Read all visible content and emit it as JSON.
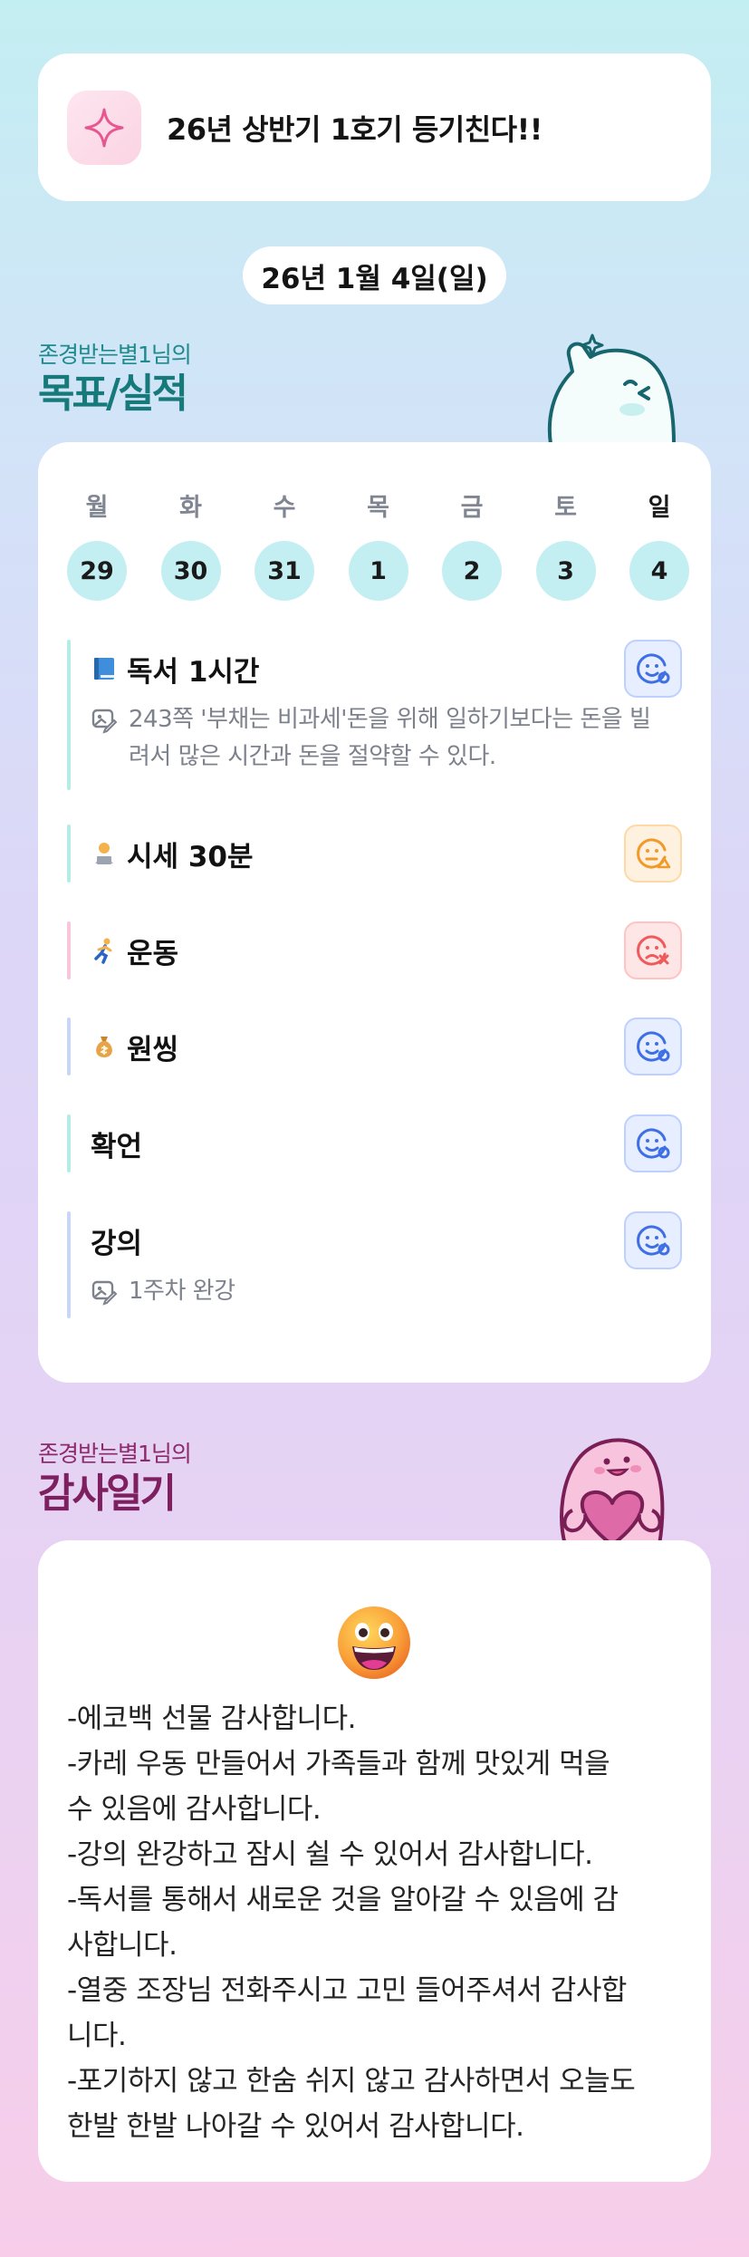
{
  "banner": {
    "text": "26년 상반기 1호기 등기친다!!",
    "icon": "sparkle-icon"
  },
  "date": "26년 1월 4일(일)",
  "goals_section": {
    "subtitle": "존경받는별1님의",
    "title": "목표/실적"
  },
  "week": [
    {
      "day": "월",
      "num": "29",
      "today": false
    },
    {
      "day": "화",
      "num": "30",
      "today": false
    },
    {
      "day": "수",
      "num": "31",
      "today": false
    },
    {
      "day": "목",
      "num": "1",
      "today": false
    },
    {
      "day": "금",
      "num": "2",
      "today": false
    },
    {
      "day": "토",
      "num": "3",
      "today": false
    },
    {
      "day": "일",
      "num": "4",
      "today": true
    }
  ],
  "tasks": [
    {
      "title": "독서 1시간",
      "emoji": "blue-book-icon",
      "note": "243쪽 '부채는 비과세'돈을 위해 일하기보다는 돈을 빌려서 많은 시간과 돈을 절약할 수 있다.",
      "mood": "good",
      "bar_color": "#b4ece7"
    },
    {
      "title": "시세 30분",
      "emoji": "laptop-person-icon",
      "note": "",
      "mood": "meh",
      "bar_color": "#b4ece7"
    },
    {
      "title": "운동",
      "emoji": "runner-icon",
      "note": "",
      "mood": "bad",
      "bar_color": "#f7c6dc"
    },
    {
      "title": "원씽",
      "emoji": "money-bag-icon",
      "note": "",
      "mood": "good",
      "bar_color": "#c9d6f5"
    },
    {
      "title": "확언",
      "emoji": "",
      "note": "",
      "mood": "good",
      "bar_color": "#b4ece7"
    },
    {
      "title": "강의",
      "emoji": "",
      "note": "1주차 완강",
      "mood": "good",
      "bar_color": "#c9d6f5"
    }
  ],
  "thanks_section": {
    "subtitle": "존경받는별1님의",
    "title": "감사일기"
  },
  "thanks": {
    "emoji": "grinning-face-icon",
    "lines": [
      "-에코백 선물 감사합니다.",
      "-카레 우동 만들어서 가족들과 함께 맛있게 먹을",
      "수 있음에 감사합니다.",
      "-강의 완강하고 잠시 쉴 수 있어서 감사합니다.",
      "-독서를 통해서 새로운 것을 알아갈 수 있음에 감",
      "사합니다.",
      "-열중 조장님 전화주시고 고민 들어주셔서 감사합",
      "니다.",
      "-포기하지 않고 한숨 쉬지 않고 감사하면서 오늘도",
      "한발 한발 나아갈 수 있어서 감사합니다."
    ]
  },
  "colors": {
    "goal_accent": "#16797a",
    "thanks_accent": "#7e1f5f",
    "day_circle": "#c4eff2"
  }
}
